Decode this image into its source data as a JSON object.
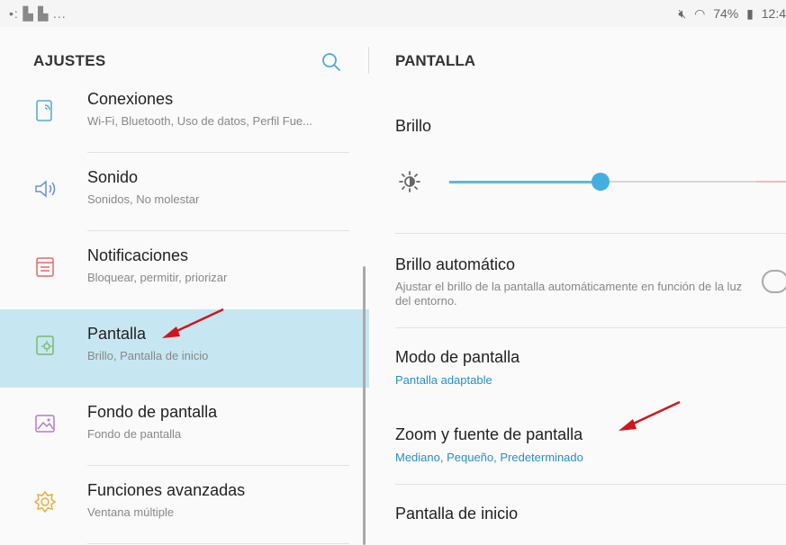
{
  "status_bar": {
    "left_icons": "•: ▌▌ ...",
    "right_icons": [
      "♪̸",
      "wifi",
      "74%",
      "battery",
      "12:4"
    ]
  },
  "left": {
    "title": "AJUSTES",
    "items": [
      {
        "icon": "connections-icon",
        "title": "Conexiones",
        "subtitle": "Wi-Fi, Bluetooth, Uso de datos, Perfil Fue..."
      },
      {
        "icon": "sound-icon",
        "title": "Sonido",
        "subtitle": "Sonidos, No molestar"
      },
      {
        "icon": "notifications-icon",
        "title": "Notificaciones",
        "subtitle": "Bloquear, permitir, priorizar"
      },
      {
        "icon": "display-icon",
        "title": "Pantalla",
        "subtitle": "Brillo, Pantalla de inicio"
      },
      {
        "icon": "wallpaper-icon",
        "title": "Fondo de pantalla",
        "subtitle": "Fondo de pantalla"
      },
      {
        "icon": "advanced-features-icon",
        "title": "Funciones avanzadas",
        "subtitle": "Ventana múltiple"
      }
    ],
    "selected_index": 3
  },
  "right": {
    "title": "PANTALLA",
    "brightness": {
      "label": "Brillo",
      "level": 0.45
    },
    "auto_brightness": {
      "title": "Brillo automático",
      "subtitle": "Ajustar el brillo de la pantalla automáticamente en función de la luz del entorno.",
      "enabled": false
    },
    "screen_mode": {
      "title": "Modo de pantalla",
      "subtitle": "Pantalla adaptable"
    },
    "zoom_font": {
      "title": "Zoom y fuente de pantalla",
      "subtitle": "Mediano, Pequeño, Predeterminado"
    },
    "home_screen": {
      "title": "Pantalla de inicio"
    }
  },
  "colors": {
    "accent": "#45aee0",
    "selected_bg": "#c6e6f1",
    "subtitle_blue": "#2a8fc7",
    "arrow_red": "#d0151c"
  }
}
